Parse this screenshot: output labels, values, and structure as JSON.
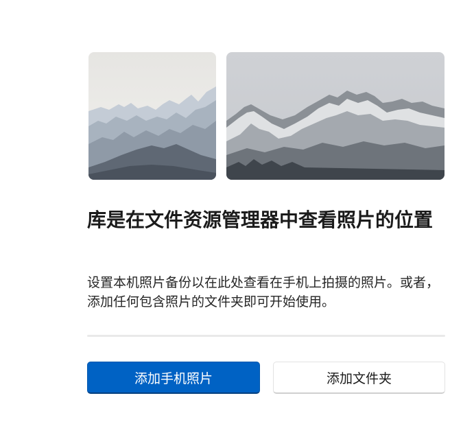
{
  "images": {
    "left": "misty-mountain-range-photo",
    "right": "snowy-mountain-peaks-photo"
  },
  "heading": "库是在文件资源管理器中查看照片的位置",
  "description": "设置本机照片备份以在此处查看在手机上拍摄的照片。或者，添加任何包含照片的文件夹即可开始使用。",
  "buttons": {
    "add_phone_photos": "添加手机照片",
    "add_folder": "添加文件夹"
  },
  "colors": {
    "accent": "#0062c4",
    "divider": "#e9e9e9"
  }
}
